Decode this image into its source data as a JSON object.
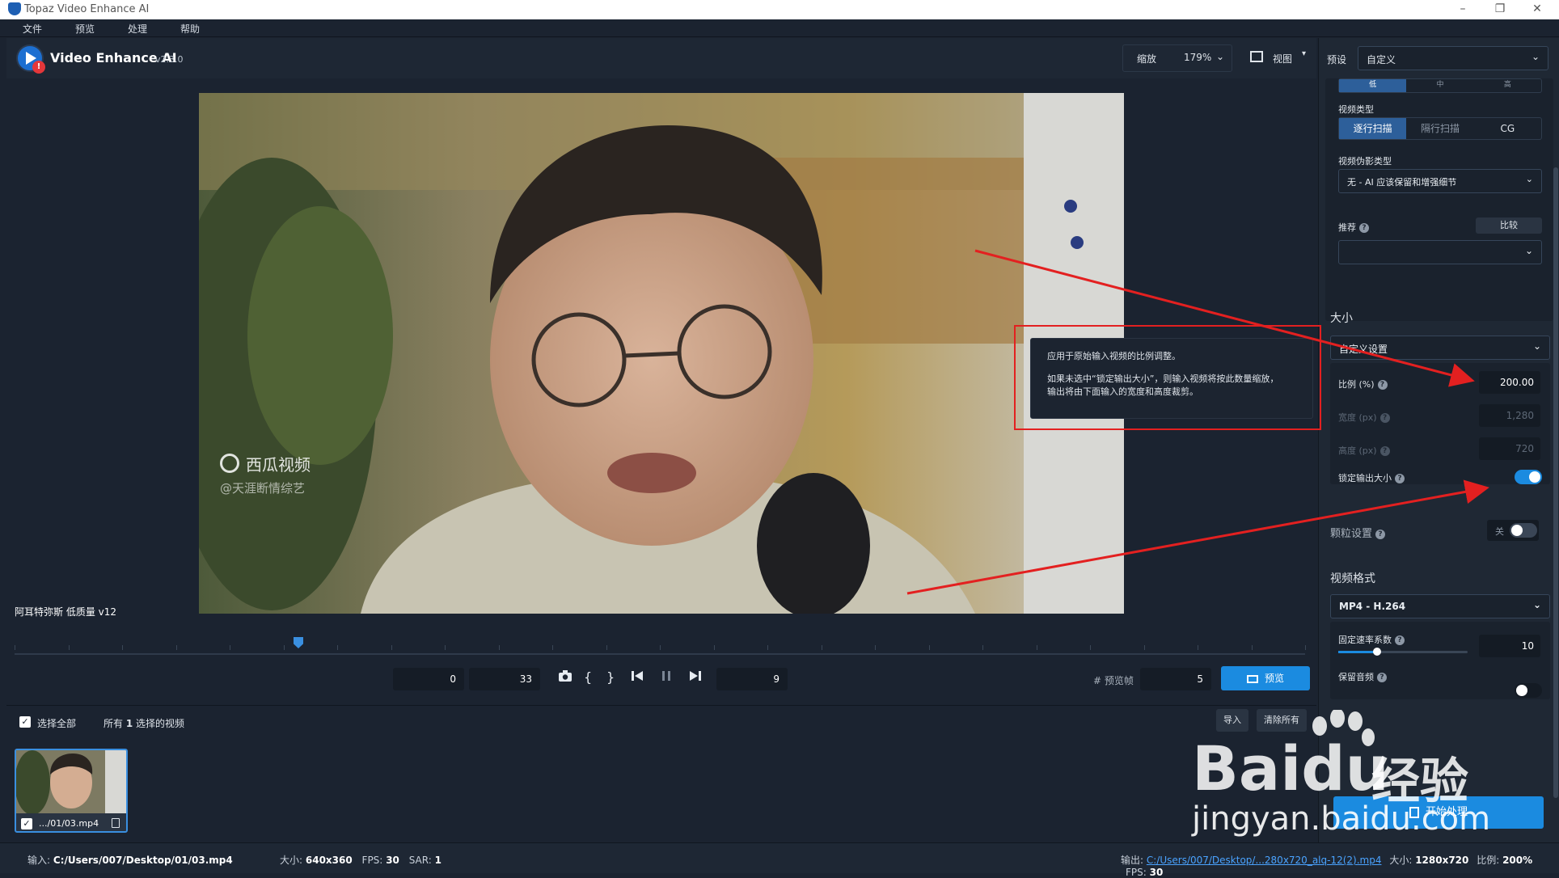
{
  "window": {
    "title": "Topaz Video Enhance AI",
    "minimize": "–",
    "maximize": "❐",
    "close": "✕"
  },
  "menu": [
    "文件",
    "预览",
    "处理",
    "帮助"
  ],
  "header": {
    "app_name": "Video Enhance AI",
    "version": "v2.3.0",
    "zoom_label": "缩放",
    "zoom_value": "179%",
    "view_label": "视图"
  },
  "right_panel": {
    "preset_label": "预设",
    "preset_value": "自定义",
    "top_tabs": [
      "低",
      "中",
      "高"
    ],
    "video_type_label": "视频类型",
    "video_type_options": [
      "逐行扫描",
      "隔行扫描",
      "CG"
    ],
    "artifact_label": "视频伪影类型",
    "artifact_value": "无 - AI 应该保留和增强细节",
    "recommend_label": "推荐",
    "compare_button": "比较",
    "size_title": "大小",
    "size_preset": "自定义设置",
    "scale_label": "比例 (%)",
    "scale_value": "200.00",
    "width_label": "宽度 (px)",
    "width_value": "1,280",
    "height_label": "高度 (px)",
    "height_value": "720",
    "lock_label": "锁定输出大小",
    "lock_on": true,
    "grain_label": "颗粒设置",
    "grain_toggle_text": "关",
    "format_title": "视频格式",
    "format_value": "MP4 - H.264",
    "crf_label": "固定速率系数",
    "crf_value": "10",
    "crf_slider_level": 0.3,
    "audio_label": "保留音频",
    "start_button": "开始处理"
  },
  "tooltip": {
    "line1": "应用于原始输入视频的比例调整。",
    "line2": "如果未选中“锁定输出大小”，则输入视频将按此数量缩放，",
    "line3": "输出将由下面输入的宽度和高度裁剪。"
  },
  "video": {
    "watermark_brand": "西瓜视频",
    "watermark_handle": "@天涯断情综艺",
    "filename_label": "阿耳特弥斯 低质量 v12"
  },
  "timeline": {
    "playhead_fraction": 0.22
  },
  "controls": {
    "start_frame": "0",
    "end_frame": "33",
    "current_frame": "9",
    "preview_frames_label": "# 预览帧",
    "preview_frames_value": "5",
    "preview_button": "预览"
  },
  "list": {
    "select_all": "选择全部",
    "summary_prefix": "所有",
    "summary_count": "1",
    "summary_suffix": "选择的视频",
    "import_button": "导入",
    "clear_button": "清除所有",
    "thumb_name": ".../01/03.mp4"
  },
  "status": {
    "input_label": "输入:",
    "input_path": "C:/Users/007/Desktop/01/03.mp4",
    "input_size_label": "大小:",
    "input_size": "640x360",
    "input_fps_label": "FPS:",
    "input_fps": "30",
    "sar_label": "SAR:",
    "sar": "1",
    "output_label": "输出:",
    "output_path": "C:/Users/007/Desktop/...280x720_alq-12(2).mp4",
    "output_size_label": "大小:",
    "output_size": "1280x720",
    "ratio_label": "比例:",
    "ratio": "200%",
    "output_fps_label": "FPS:",
    "output_fps": "30"
  },
  "overlay": {
    "baidu_word": "Bai",
    "baidu_du": "du",
    "baidu_cn": "经验",
    "baidu_url": "jingyan.baidu.com"
  },
  "colors": {
    "accent": "#1b8be0",
    "annotation_red": "#e32020",
    "panel_bg": "#1f2834"
  }
}
